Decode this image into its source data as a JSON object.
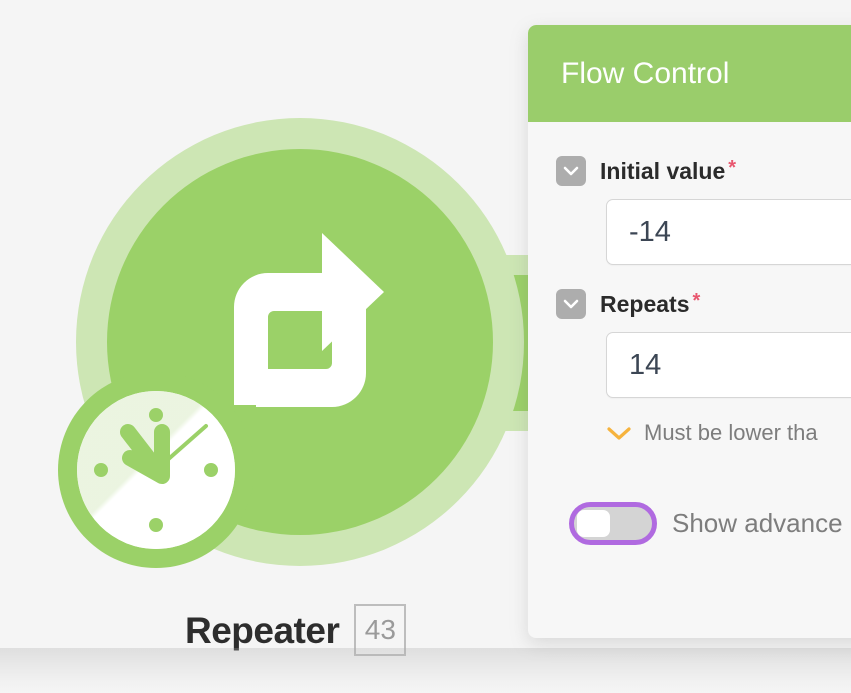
{
  "canvas": {
    "background_color": "#f5f5f5"
  },
  "node": {
    "title": "Repeater",
    "count_badge": "43",
    "icon_name": "repeat-loop-icon",
    "badge_icon_name": "clock-icon",
    "accent_color": "#9bd168",
    "halo_color": "#cde6b4"
  },
  "panel": {
    "title": "Flow Control",
    "header_color": "#9acd6b",
    "background_color": "#f7f7f7",
    "fields": [
      {
        "label": "Initial value",
        "required_marker": "*",
        "value": "-14",
        "collapse_icon": "chevron-down-icon"
      },
      {
        "label": "Repeats",
        "required_marker": "*",
        "value": "14",
        "collapse_icon": "chevron-down-icon"
      }
    ],
    "hint": {
      "icon": "chevron-down-icon",
      "icon_color": "#f6b33d",
      "text": "Must be lower tha"
    },
    "toggle": {
      "label": "Show advance",
      "state": "off",
      "focus_ring_color": "#b06ae0",
      "track_color": "#d4d4d4",
      "knob_color": "#ffffff"
    }
  }
}
